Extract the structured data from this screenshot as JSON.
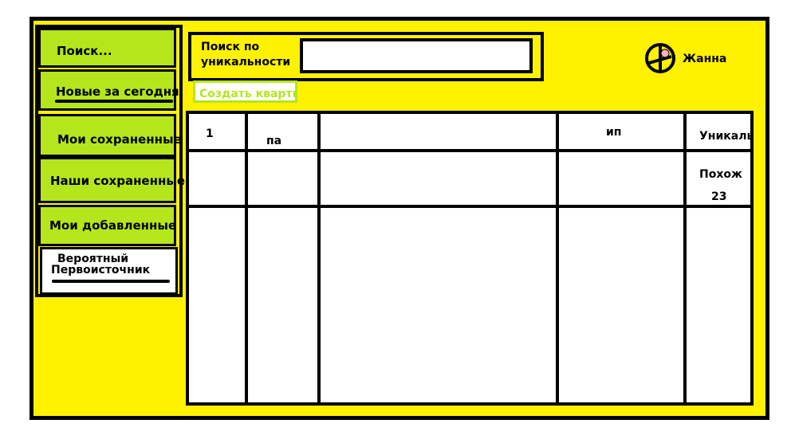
{
  "sidebar": {
    "items": [
      {
        "label": "Поиск..."
      },
      {
        "label": "Новые за сегодня"
      },
      {
        "label": "Мои сохраненные"
      },
      {
        "label": "Наши сохраненные"
      },
      {
        "label": "Мои добавленные"
      }
    ],
    "source_item": {
      "line1": "Вероятный",
      "line2": "Первоисточник"
    }
  },
  "search": {
    "label_line1": "Поиск по",
    "label_line2": "уникальности",
    "value": "",
    "placeholder": ""
  },
  "create_button": {
    "label": "Создать кварти"
  },
  "user": {
    "name": "Жанна",
    "icon": "user-avatar-icon"
  },
  "table": {
    "headers": [
      "1",
      "па",
      "",
      "ип",
      "Уникаль"
    ],
    "rows": [
      [
        "",
        "",
        "",
        "",
        "Похож"
      ],
      [
        "",
        "",
        "",
        "",
        "23"
      ]
    ]
  },
  "colors": {
    "background": "#fff200",
    "accent": "#b5e61d",
    "border": "#000000"
  }
}
